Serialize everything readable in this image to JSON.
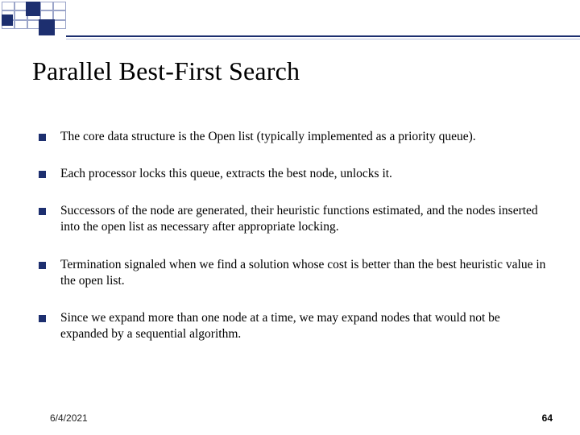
{
  "title": "Parallel Best-First Search",
  "bullets": [
    "The core data structure is the Open list (typically implemented as a priority queue).",
    "Each processor locks this queue, extracts the best node, unlocks it.",
    "Successors of the node are generated, their heuristic functions estimated, and the nodes inserted into the open list as necessary after appropriate locking.",
    "Termination signaled when we find a solution whose cost is better than the best heuristic value in the open list.",
    "Since we expand more than one node at a time, we may expand nodes that would not be expanded by a sequential algorithm."
  ],
  "footer": {
    "date": "6/4/2021",
    "page": "64"
  }
}
